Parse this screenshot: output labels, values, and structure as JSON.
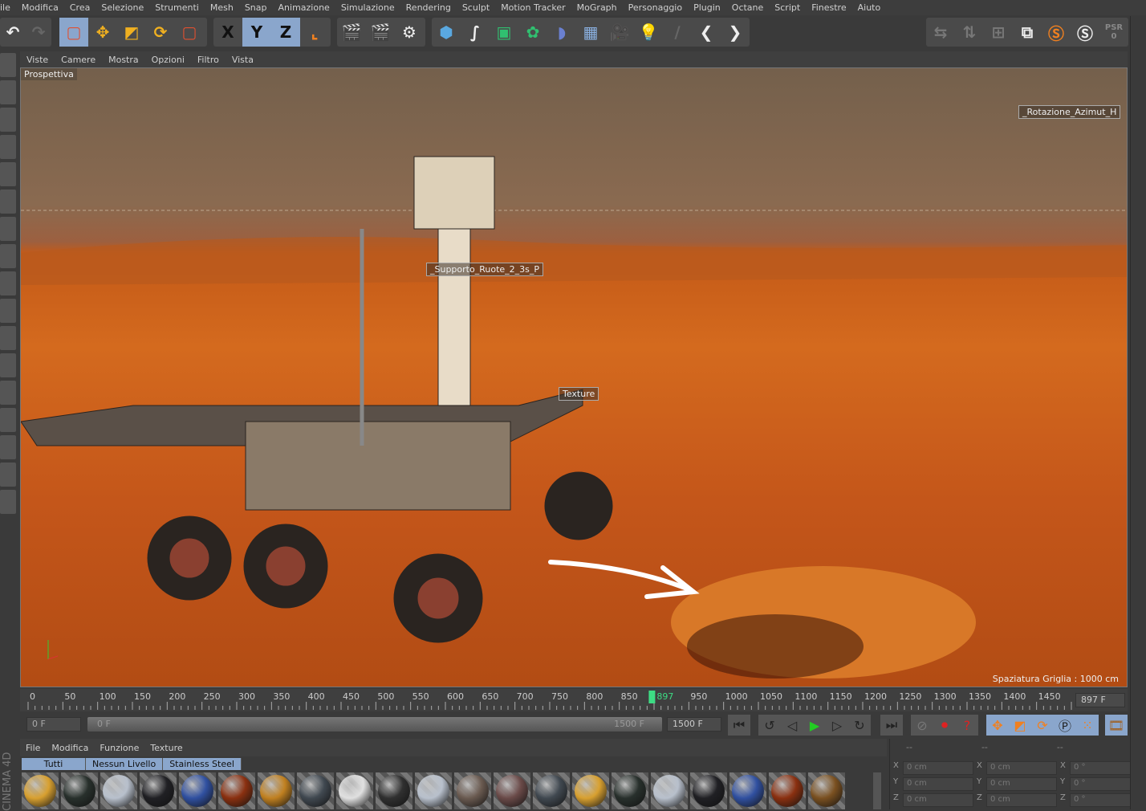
{
  "menubar": [
    "ile",
    "Modifica",
    "Crea",
    "Selezione",
    "Strumenti",
    "Mesh",
    "Snap",
    "Animazione",
    "Simulazione",
    "Rendering",
    "Sculpt",
    "Motion Tracker",
    "MoGraph",
    "Personaggio",
    "Plugin",
    "Octane",
    "Script",
    "Finestre",
    "Aiuto"
  ],
  "toolbar": {
    "axis_x": "X",
    "axis_y": "Y",
    "axis_z": "Z",
    "psr": "PSR",
    "psr_value": "0"
  },
  "viewport": {
    "menu": [
      "Viste",
      "Camere",
      "Mostra",
      "Opzioni",
      "Filtro",
      "Vista"
    ],
    "camera_label": "Prospettiva",
    "label_azimut": "_Rotazione_Azimut_H",
    "label_supporto": "_Supporto_Ruote_2_3s_P",
    "label_texture": "Texture",
    "grid_spacing": "Spaziatura Griglia : 1000 cm",
    "accent": "#d4621c"
  },
  "timeline": {
    "min": 0,
    "max": 1500,
    "step": 50,
    "current": 897,
    "current_label": "897",
    "current_field": "897 F"
  },
  "controls": {
    "start_field": "0 F",
    "slider_start": "0 F",
    "slider_end": "1500 F",
    "end_field": "1500 F"
  },
  "materials": {
    "menu": [
      "File",
      "Modifica",
      "Funzione",
      "Texture"
    ],
    "tabs": [
      "Tutti",
      "Nessun Livello",
      "Stainless Steel"
    ],
    "swatches": [
      "#d8a030",
      "#28302c",
      "#b8c0cc",
      "#202024",
      "#3050a0",
      "#8a3010",
      "#c08020",
      "#404850",
      "#e0e0e0",
      "#303030",
      "#b8c0cc",
      "#6a5a50",
      "#6a4a48",
      "#404850",
      "#d8a030",
      "#28302c",
      "#b8c0cc",
      "#202024",
      "#3050a0",
      "#8a3010",
      "#7a5020"
    ]
  },
  "coords": {
    "headers": [
      "--",
      "--",
      "--"
    ],
    "rows": [
      {
        "axis": "X",
        "pos": "0 cm",
        "size": "0 cm",
        "rot": "0 °"
      },
      {
        "axis": "Y",
        "pos": "0 cm",
        "size": "0 cm",
        "rot": "0 °"
      },
      {
        "axis": "Z",
        "pos": "0 cm",
        "size": "0 cm",
        "rot": "0 °"
      }
    ]
  },
  "branding": "CINEMA 4D"
}
